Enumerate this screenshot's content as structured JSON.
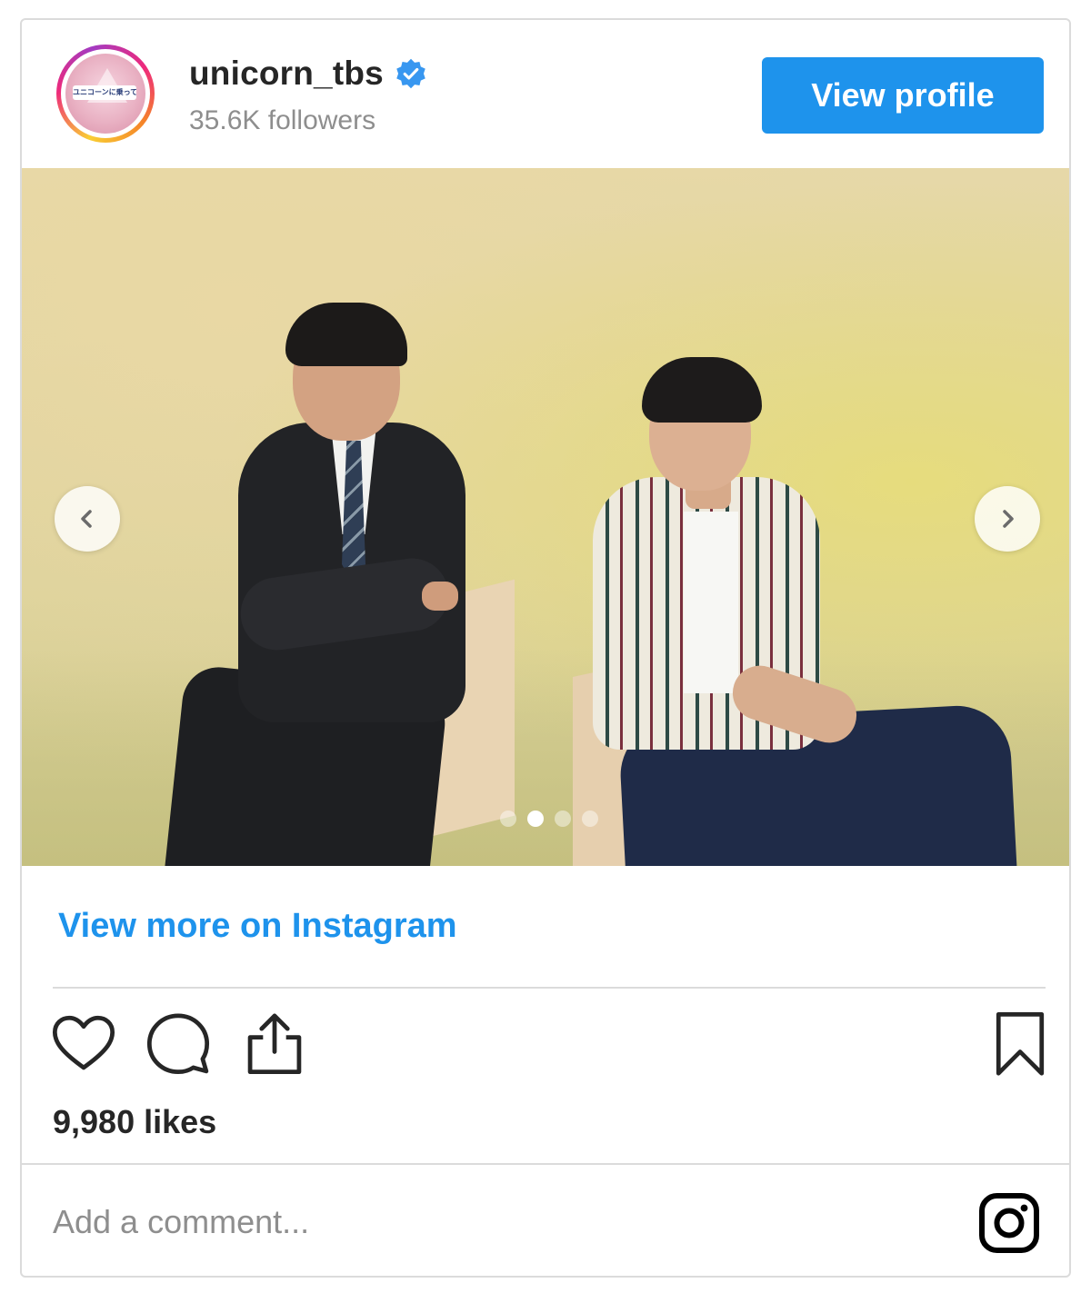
{
  "header": {
    "username": "unicorn_tbs",
    "verified": true,
    "followers": "35.6K followers",
    "view_profile_label": "View profile",
    "avatar_logo_text": "ユニコーンに乗って"
  },
  "carousel": {
    "slide_count": 4,
    "active_index": 1
  },
  "footer": {
    "more_link": "View more on Instagram",
    "likes": "9,980 likes",
    "comment_placeholder": "Add a comment..."
  },
  "icons": {
    "like": "heart-icon",
    "comment": "comment-icon",
    "share": "share-icon",
    "save": "bookmark-icon",
    "instagram": "instagram-icon"
  },
  "colors": {
    "accent": "#1e93ec",
    "text": "#262626",
    "muted": "#8e8e8e",
    "border": "#dbdbdb"
  }
}
